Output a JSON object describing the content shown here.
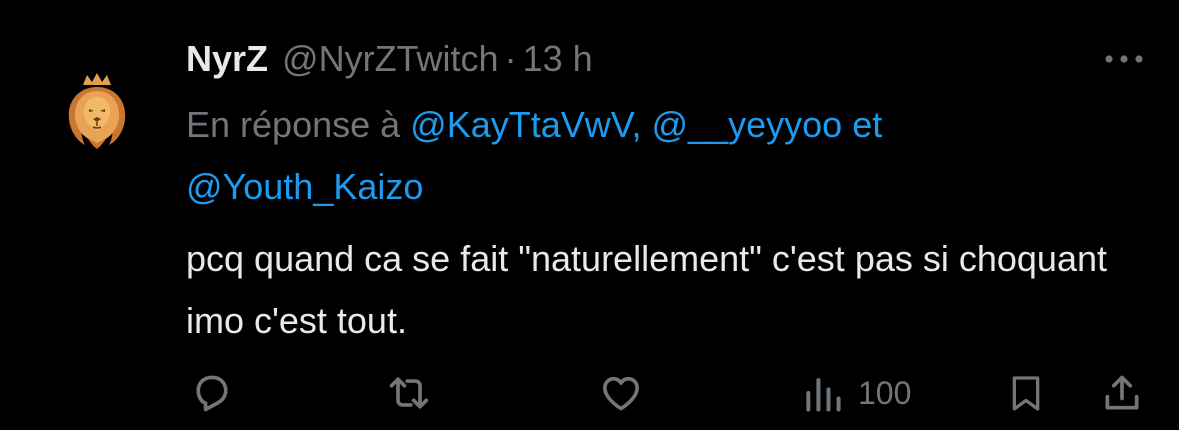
{
  "tweet": {
    "display_name": "NyrZ",
    "handle": "@NyrZTwitch",
    "separator": "·",
    "time": "13 h",
    "reply_prefix": "En réponse à",
    "mentions": [
      "@KayTtaVwV",
      "@__yeyyoo",
      "@Youth_Kaizo"
    ],
    "mention_separator": ",",
    "mention_conjunction": "et",
    "text": "pcq quand ca se fait \"naturellement\" c'est pas si choquant imo c'est tout."
  },
  "actions": {
    "views": "100"
  },
  "icons": {
    "avatar": "lion-crown-avatar",
    "more": "more-horizontal-icon",
    "reply": "reply-icon",
    "retweet": "retweet-icon",
    "like": "heart-icon",
    "views": "views-bar-chart-icon",
    "bookmark": "bookmark-icon",
    "share": "share-icon"
  },
  "colors": {
    "background": "#000000",
    "text": "#e7e9ea",
    "secondary": "#71767b",
    "link": "#1d9bf0",
    "avatar_accent": "#d98a3a"
  }
}
